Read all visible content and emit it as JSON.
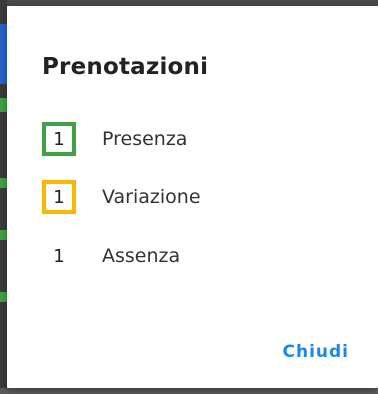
{
  "dialog": {
    "title": "Prenotazioni",
    "rows": [
      {
        "count": "1",
        "label": "Presenza",
        "border_color": "#43a047"
      },
      {
        "count": "1",
        "label": "Variazione",
        "border_color": "#f9b800"
      },
      {
        "count": "1",
        "label": "Assenza",
        "border_color": ""
      }
    ],
    "close_label": "Chiudi",
    "close_color": "#1e88e5"
  },
  "backdrop": {
    "color": "#3b3b3b",
    "accent_colors": [
      "#2b63c7",
      "#43a047"
    ]
  }
}
